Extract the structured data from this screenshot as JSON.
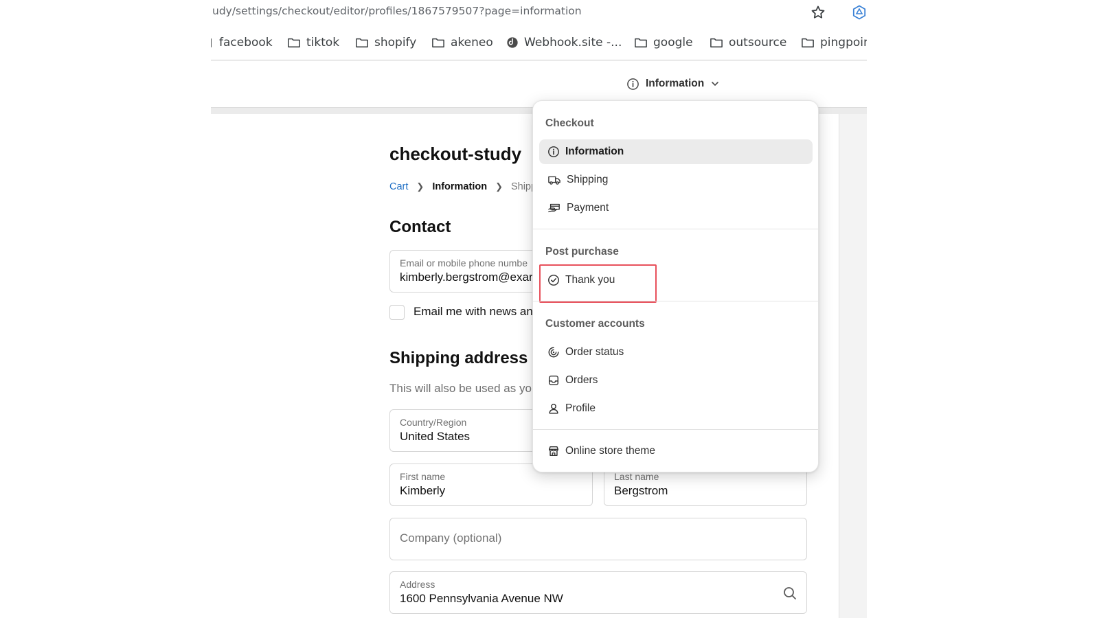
{
  "browser": {
    "url": "udy/settings/checkout/editor/profiles/1867579507?page=information",
    "bookmarks": [
      {
        "label": "facebook",
        "icon": "folder-icon"
      },
      {
        "label": "tiktok",
        "icon": "folder-icon"
      },
      {
        "label": "shopify",
        "icon": "folder-icon"
      },
      {
        "label": "akeneo",
        "icon": "folder-icon"
      },
      {
        "label": "Webhook.site -...",
        "icon": "webhook-favicon"
      },
      {
        "label": "google",
        "icon": "folder-icon"
      },
      {
        "label": "outsource",
        "icon": "folder-icon"
      },
      {
        "label": "pingpoir",
        "icon": "folder-icon"
      }
    ]
  },
  "editor": {
    "page_selector_label": "Information"
  },
  "dropdown": {
    "groups": [
      {
        "title": "Checkout",
        "items": [
          {
            "label": "Information",
            "icon": "info-icon",
            "selected": true
          },
          {
            "label": "Shipping",
            "icon": "truck-icon"
          },
          {
            "label": "Payment",
            "icon": "payment-icon"
          }
        ]
      },
      {
        "title": "Post purchase",
        "items": [
          {
            "label": "Thank you",
            "icon": "check-circle-icon",
            "highlighted": true
          }
        ]
      },
      {
        "title": "Customer accounts",
        "items": [
          {
            "label": "Order status",
            "icon": "order-status-icon"
          },
          {
            "label": "Orders",
            "icon": "inbox-icon"
          },
          {
            "label": "Profile",
            "icon": "person-icon"
          }
        ]
      },
      {
        "title": "",
        "items": [
          {
            "label": "Online store theme",
            "icon": "store-icon"
          }
        ]
      }
    ]
  },
  "preview": {
    "shop_name": "checkout-study",
    "breadcrumb": [
      "Cart",
      "Information",
      "Shipp"
    ],
    "contact_heading": "Contact",
    "email_field": {
      "label": "Email or mobile phone numbe",
      "value": "kimberly.bergstrom@exar"
    },
    "newsletter_label": "Email me with news an",
    "shipping_heading": "Shipping address",
    "shipping_subtitle": "This will also be used as yo",
    "country_field": {
      "label": "Country/Region",
      "value": "United States"
    },
    "first_name_field": {
      "label": "First name",
      "value": "Kimberly"
    },
    "last_name_field": {
      "label": "Last name",
      "value": "Bergstrom"
    },
    "company_field": {
      "placeholder": "Company (optional)"
    },
    "address_field": {
      "label": "Address",
      "value": "1600 Pennsylvania Avenue NW"
    }
  },
  "colors": {
    "accent_link": "#1f6fc5",
    "highlight_box": "#e8505b",
    "selected_bg": "#ebebeb"
  }
}
